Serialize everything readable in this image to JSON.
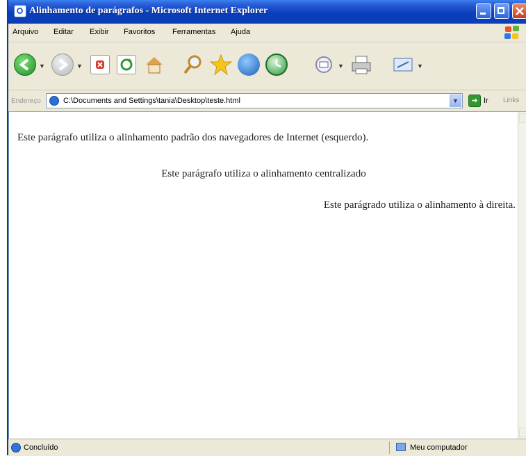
{
  "window": {
    "title": "Alinhamento de parágrafos - Microsoft Internet Explorer",
    "controls": {
      "minimize": "minimize",
      "maximize": "maximize",
      "close": "close"
    }
  },
  "menu": [
    "Arquivo",
    "Editar",
    "Exibir",
    "Favoritos",
    "Ferramentas",
    "Ajuda"
  ],
  "toolbar": {
    "icons": [
      "back-icon",
      "forward-icon",
      "stop-icon",
      "refresh-icon",
      "home-icon",
      "search-icon",
      "favorites-icon",
      "media-icon",
      "history-icon",
      "mail-icon",
      "print-icon",
      "edit-icon"
    ]
  },
  "address": {
    "label": "Endereço",
    "value": "C:\\Documents and Settings\\tania\\Desktop\\teste.html",
    "go_label": "Ir",
    "links_label": "Links"
  },
  "content": {
    "paragraphs": [
      {
        "text": "Este parágrafo utiliza o alinhamento padrão dos navegadores de Internet (esquerdo).",
        "align": "left"
      },
      {
        "text": "Este parágrafo utiliza o alinhamento centralizado",
        "align": "center"
      },
      {
        "text": "Este parágrado utiliza o alinhamento à direita.",
        "align": "right"
      }
    ]
  },
  "status": {
    "left": "Concluído",
    "zone": "Meu computador"
  },
  "colors": {
    "titlebar": "#0a3eba",
    "chrome": "#ece9d8",
    "content_bg": "#ffffff"
  }
}
